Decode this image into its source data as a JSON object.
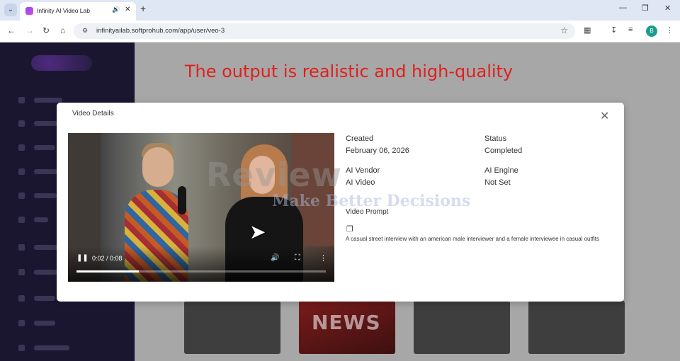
{
  "browser": {
    "tab_title": "Infinity AI Video Lab",
    "url": "infinityailab.softprohub.com/app/user/veo-3",
    "profile_initial": "B",
    "colors": {
      "profile": "#1c9c8f",
      "tab_strip": "#dfe7f5"
    }
  },
  "background_page": {
    "thumbnail_text": "NEWS"
  },
  "caption": {
    "text": "The output is realistic and high-quality",
    "color": "#e0201d"
  },
  "modal": {
    "title": "Video Details",
    "close_icon": "close-icon",
    "video": {
      "current_time": "0:02",
      "duration": "0:08",
      "time_display": "0:02 / 0:08",
      "progress": 0.25
    },
    "details": {
      "created_label": "Created",
      "created_value": "February 06, 2026",
      "status_label": "Status",
      "status_value": "Completed",
      "vendor_label": "AI Vendor",
      "vendor_value": "AI Video",
      "engine_label": "AI Engine",
      "engine_value": "Not Set",
      "prompt_label": "Video Prompt",
      "prompt_text": "A casual street interview with an american male interviewer and a female interviewee in casual outfits"
    }
  },
  "watermark": {
    "line1": "Review",
    "line2": "Make Better Decisions"
  }
}
